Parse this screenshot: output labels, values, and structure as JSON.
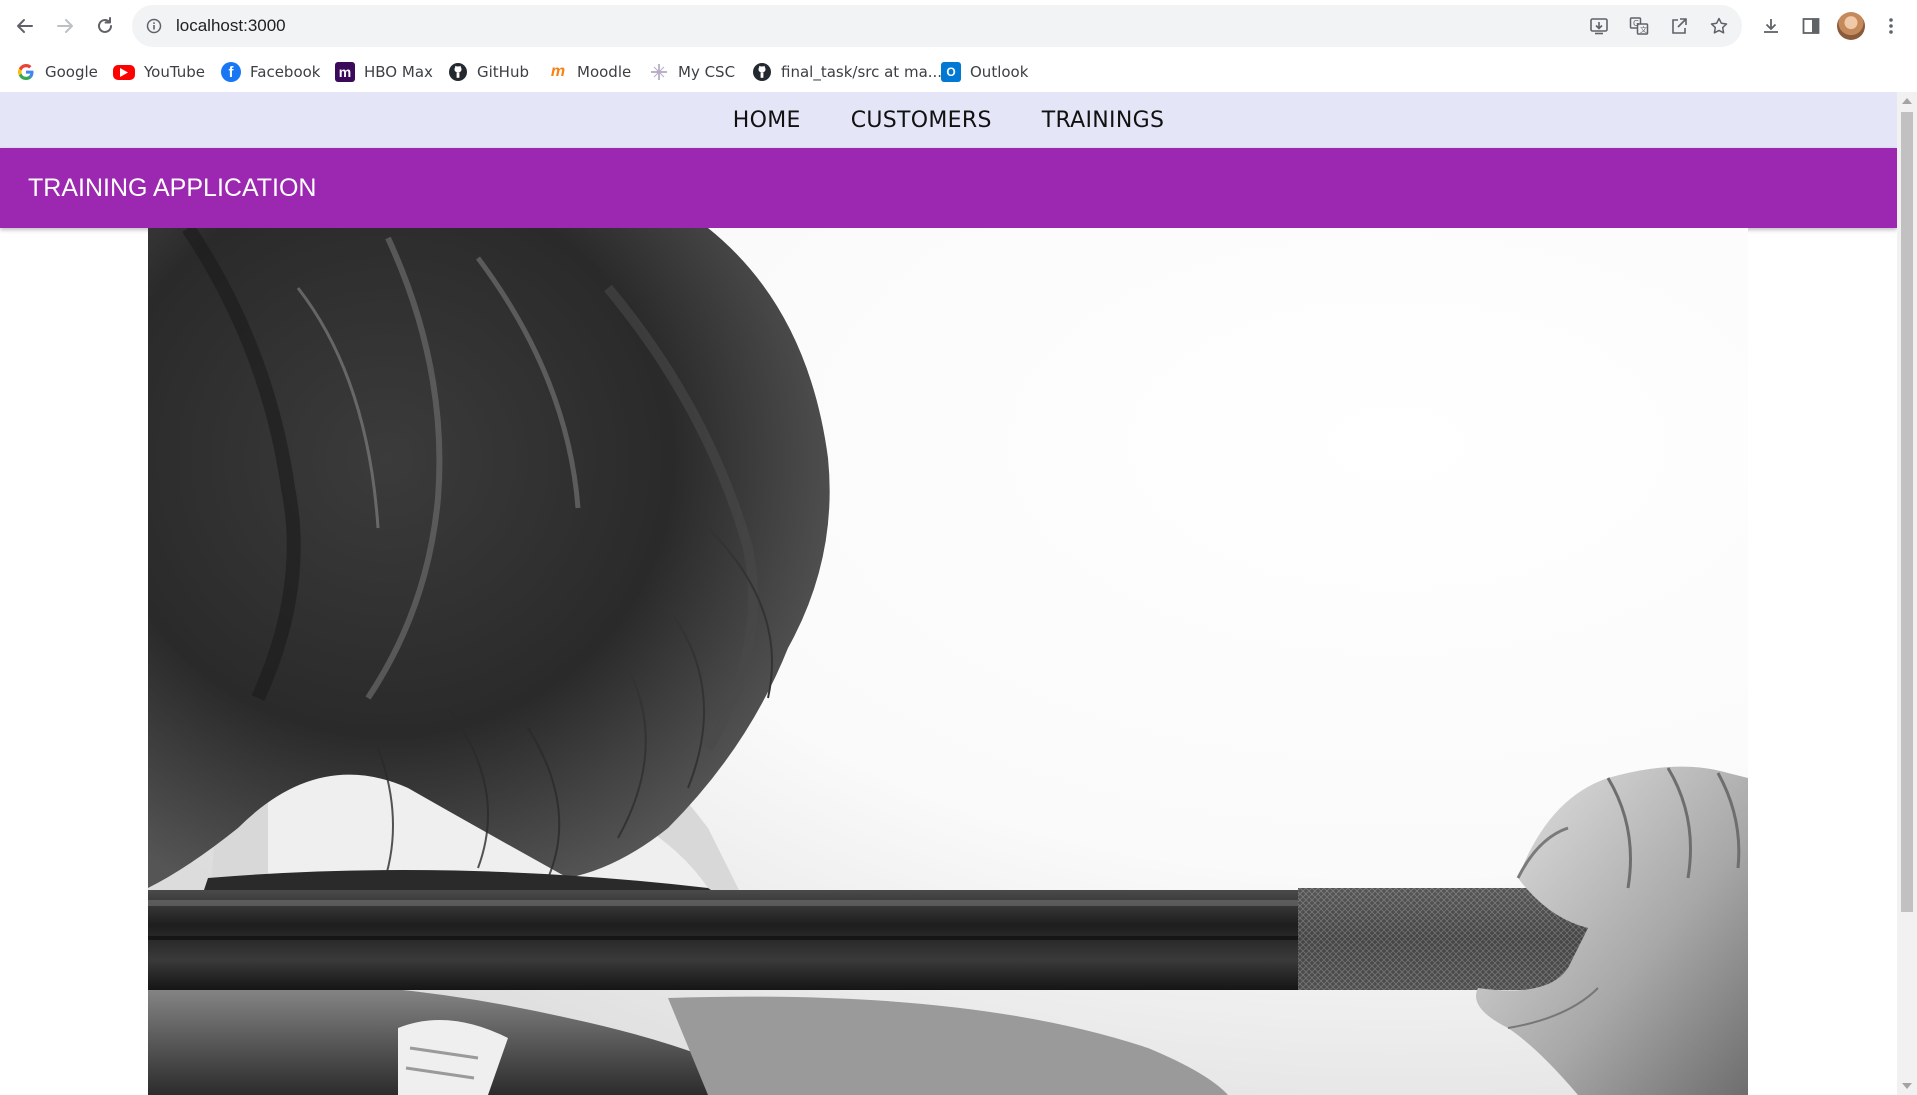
{
  "browser": {
    "url": "localhost:3000",
    "nav_icons": [
      "back-arrow-icon",
      "forward-arrow-icon",
      "reload-icon"
    ],
    "omnibox_actions": [
      "install-app-icon",
      "translate-icon",
      "share-icon",
      "bookmark-star-icon"
    ],
    "right_actions": [
      "download-icon",
      "side-panel-icon",
      "profile-avatar",
      "more-menu-icon"
    ]
  },
  "bookmarks": [
    {
      "label": "Google",
      "icon": "google-icon",
      "color": "#4285f4"
    },
    {
      "label": "YouTube",
      "icon": "youtube-icon",
      "color": "#ff0000"
    },
    {
      "label": "Facebook",
      "icon": "facebook-icon",
      "color": "#1877f2"
    },
    {
      "label": "HBO Max",
      "icon": "hbo-max-icon",
      "color": "#4a1b6e"
    },
    {
      "label": "GitHub",
      "icon": "github-icon",
      "color": "#24292f"
    },
    {
      "label": "Moodle",
      "icon": "moodle-icon",
      "color": "#f98012"
    },
    {
      "label": "My CSC",
      "icon": "mycsc-icon",
      "color": "#8a8a8a"
    },
    {
      "label": "final_task/src at ma...",
      "icon": "github-icon",
      "color": "#24292f"
    },
    {
      "label": "Outlook",
      "icon": "outlook-icon",
      "color": "#0078d4"
    }
  ],
  "app": {
    "nav_links": [
      "HOME",
      "CUSTOMERS",
      "TRAININGS"
    ],
    "title": "TRAINING APPLICATION",
    "colors": {
      "nav_background": "#e4e6f8",
      "app_bar": "#9c27b0"
    },
    "hero_image": "grayscale photo of a woman holding a barbell across her shoulders"
  }
}
